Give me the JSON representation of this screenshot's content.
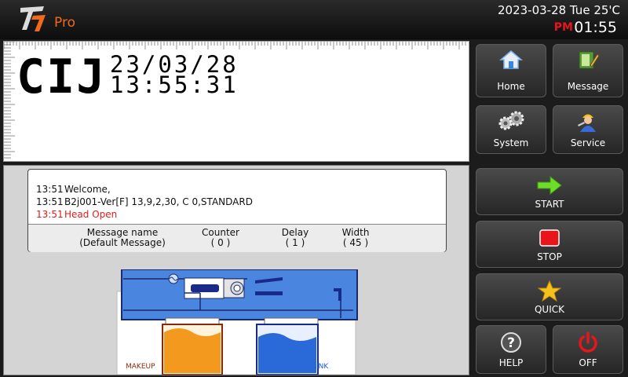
{
  "header": {
    "brand_sub": "Pro",
    "date": "2023-03-28 Tue 25'C",
    "ampm": "PM",
    "time": "01:55"
  },
  "preview": {
    "main_text": "CIJ",
    "date_text": "23/03/28",
    "time_text": "13:55:31"
  },
  "log": [
    {
      "time": "13:51",
      "text": "Welcome,",
      "alert": false
    },
    {
      "time": "13:51",
      "text": "B2j001-Ver[F] 13,9,2,30, C 0,STANDARD",
      "alert": false
    },
    {
      "time": "13:51",
      "text": "Head Open",
      "alert": true
    }
  ],
  "info": {
    "message_name_label": "Message name",
    "message_name_value": "(Default Message)",
    "counter_label": "Counter",
    "counter_value": "( 0 )",
    "delay_label": "Delay",
    "delay_value": "( 1 )",
    "width_label": "Width",
    "width_value": "( 45 )"
  },
  "tanks": {
    "makeup_label": "MAKEUP",
    "ink_label": "INK"
  },
  "menu": {
    "home": "Home",
    "message": "Message",
    "system": "System",
    "service": "Service",
    "start": "START",
    "stop": "STOP",
    "quick": "QUICK",
    "help": "HELP",
    "off": "OFF"
  },
  "colors": {
    "accent_orange": "#f06a1a",
    "alert_red": "#e01b1b",
    "ink_blue": "#1a5ac0",
    "start_green": "#6fdc2a",
    "stop_red": "#e8151b",
    "quick_yellow": "#f4c21c"
  }
}
